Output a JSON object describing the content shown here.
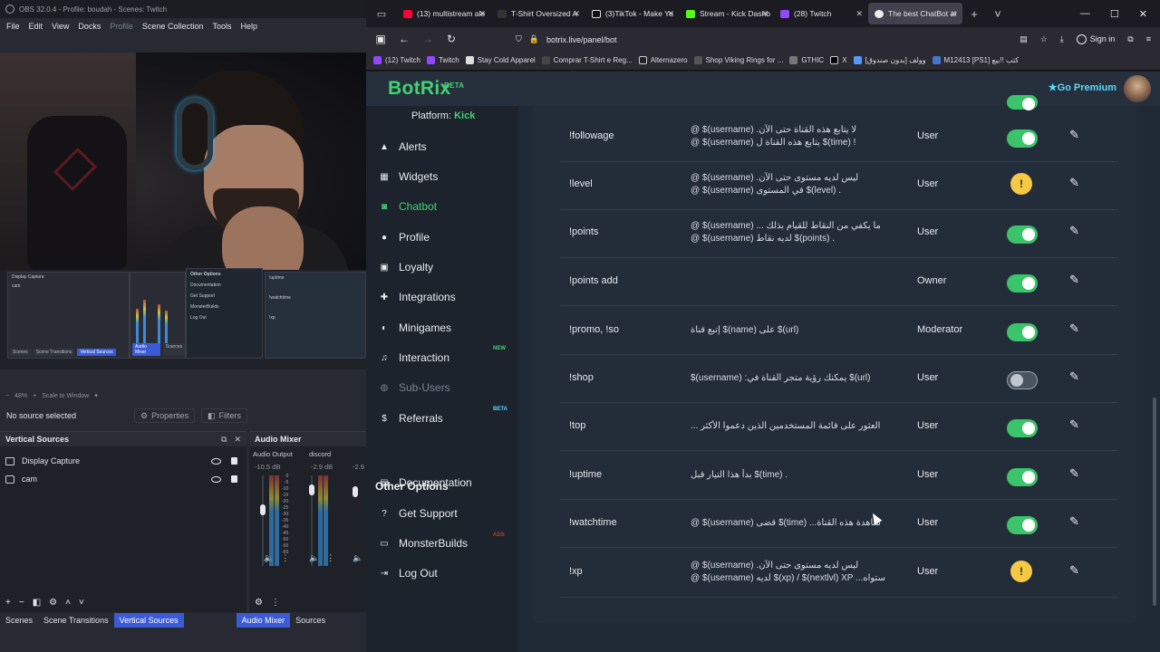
{
  "obs": {
    "title": "OBS 32.0.4 - Profile: boudah - Scenes: Twitch",
    "menu": [
      "File",
      "Edit",
      "View",
      "Docks",
      "Profile",
      "Scene Collection",
      "Tools",
      "Help"
    ],
    "mini_sources": [
      "Display Capture",
      "cam"
    ],
    "mini_tabs": [
      "Scenes",
      "Scene Transitions",
      "Vertical Sources",
      "Audio Mixer",
      "Sources"
    ],
    "mini_other_options": {
      "heading": "Other Options",
      "items": [
        "Documentation",
        "Get Support",
        "MonsterBuilds",
        "Log Out"
      ]
    },
    "mini_commands": [
      "!uptime",
      "!watchtime",
      "!xp"
    ],
    "zoom": "48%",
    "scale_label": "Scale to Window",
    "no_source": "No source selected",
    "properties_label": "Properties",
    "filters_label": "Filters",
    "vertical_sources": {
      "title": "Vertical Sources",
      "items": [
        "Display Capture",
        "cam"
      ]
    },
    "audio_mixer": {
      "title": "Audio Mixer",
      "channels": [
        {
          "name": "Audio Output",
          "db": "-10.5 dB"
        },
        {
          "name": "discord",
          "db": "-2.9 dB"
        },
        {
          "name": "",
          "db": "-2.9"
        }
      ],
      "scale": [
        "0",
        "-5",
        "-10",
        "-15",
        "-20",
        "-25",
        "-30",
        "-35",
        "-40",
        "-45",
        "-50",
        "-55",
        "-60"
      ]
    },
    "bottom_tabs_left": [
      "Scenes",
      "Scene Transitions",
      "Vertical Sources"
    ],
    "bottom_tabs_right": [
      "Audio Mixer",
      "Sources"
    ]
  },
  "browser": {
    "tabs": [
      {
        "label": "(13) multistream ale",
        "color": "#ff0033"
      },
      {
        "label": "T-Shirt Oversized A",
        "color": "#222222"
      },
      {
        "label": "(3)TikTok - Make Yo",
        "color": "#111111"
      },
      {
        "label": "Stream - Kick Dashb",
        "color": "#53fc18"
      },
      {
        "label": "(28) Twitch",
        "color": "#9146ff"
      },
      {
        "label": "The best ChatBot ar",
        "color": "#eeeeee"
      }
    ],
    "url": "botrix.live/panel/bot",
    "signin": "Sign in",
    "bookmarks": [
      {
        "label": "(12) Twitch",
        "color": "#9146ff"
      },
      {
        "label": "Twitch",
        "color": "#9146ff"
      },
      {
        "label": "Stay Cold Apparel",
        "color": "#dddddd"
      },
      {
        "label": "Comprar T-Shirt e Reg...",
        "color": "#444444"
      },
      {
        "label": "Alternazero",
        "color": "#222222"
      },
      {
        "label": "Shop Viking Rings for ...",
        "color": "#555555"
      },
      {
        "label": "GTHIC",
        "color": "#777777"
      },
      {
        "label": "X",
        "color": "#000000"
      },
      {
        "label": "وولف [بدون صندوق]",
        "color": "#5599ff"
      },
      {
        "label": "M12413 [PS1] كتب !!بيع",
        "color": "#4477cc"
      }
    ]
  },
  "botrix": {
    "logo": "BotRix",
    "logo_badge": "BETA",
    "go_premium": "Go Premium",
    "platform_label": "Platform:",
    "platform_value": "Kick",
    "sidebar": [
      {
        "label": "Alerts",
        "icon": "warning-icon"
      },
      {
        "label": "Widgets",
        "icon": "widgets-icon"
      },
      {
        "label": "Chatbot",
        "icon": "robot-icon"
      },
      {
        "label": "Profile",
        "icon": "user-icon"
      },
      {
        "label": "Loyalty",
        "icon": "gift-icon"
      },
      {
        "label": "Integrations",
        "icon": "puzzle-icon"
      },
      {
        "label": "Minigames",
        "icon": "gamepad-icon"
      },
      {
        "label": "Interaction",
        "icon": "music-icon",
        "badge": "NEW"
      },
      {
        "label": "Sub-Users",
        "icon": "users-icon"
      },
      {
        "label": "Referrals",
        "icon": "dollar-icon",
        "badge": "BETA"
      }
    ],
    "other_options": {
      "heading": "Other Options",
      "items": [
        {
          "label": "Documentation",
          "icon": "book-icon"
        },
        {
          "label": "Get Support",
          "icon": "help-icon"
        },
        {
          "label": "MonsterBuilds",
          "icon": "monitor-icon",
          "badge": "ADS"
        },
        {
          "label": "Log Out",
          "icon": "logout-icon"
        }
      ]
    },
    "commands": [
      {
        "cmd": "!followage",
        "resp": [
          "@ $(username) .لا يتابع هذه القناة حتى الآن",
          "@ $(username) يتابع هذه القناة ل $(time) !"
        ],
        "role": "User",
        "status": "on"
      },
      {
        "cmd": "!level",
        "resp": [
          "@ $(username) .ليس لديه مستوى حتى الآن",
          "@ $(username) في المستوى $(level) ."
        ],
        "role": "User",
        "status": "warn"
      },
      {
        "cmd": "!points",
        "resp": [
          "@ $(username) ... ما يكفي من النقاط للقيام بذلك",
          "@ $(username) لديه نقاط $(points) ."
        ],
        "role": "User",
        "status": "on"
      },
      {
        "cmd": "!points add",
        "resp": [],
        "role": "Owner",
        "status": "on"
      },
      {
        "cmd": "!promo, !so",
        "resp": [
          "إتبع قناة $(name) على $(url)"
        ],
        "role": "Moderator",
        "status": "on"
      },
      {
        "cmd": "!shop",
        "resp": [
          "$(username) :يمكنك رؤية متجر القناة في $(url)"
        ],
        "role": "User",
        "status": "off"
      },
      {
        "cmd": "!top",
        "resp": [
          "... العثور على قائمة المستخدمين الذين دعموا الأكثر"
        ],
        "role": "User",
        "status": "on"
      },
      {
        "cmd": "!uptime",
        "resp": [
          "بدأ هذا التيار قبل $(time) ."
        ],
        "role": "User",
        "status": "on"
      },
      {
        "cmd": "!watchtime",
        "resp": [
          "@ $(username) قضى $(time) ...شاهدة هذه القناة"
        ],
        "role": "User",
        "status": "on"
      },
      {
        "cmd": "!xp",
        "resp": [
          "@ $(username) .ليس لديه مستوى حتى الآن",
          "@ $(username) لديه $(xp) / $(nextlvl) XP ...ستواه"
        ],
        "role": "User",
        "status": "warn"
      }
    ]
  }
}
